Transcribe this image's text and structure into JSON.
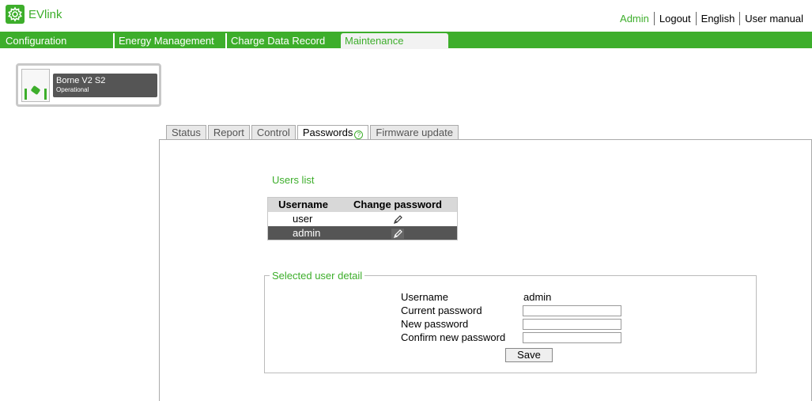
{
  "app": {
    "title": "EVlink"
  },
  "top_links": {
    "user": "Admin",
    "logout": "Logout",
    "language": "English",
    "manual": "User manual"
  },
  "nav": {
    "configuration": "Configuration",
    "energy": "Energy Management",
    "cdr": "Charge Data Record",
    "maintenance": "Maintenance"
  },
  "station": {
    "name": "Borne V2 S2",
    "status": "Operational"
  },
  "tabs": {
    "status": "Status",
    "report": "Report",
    "control": "Control",
    "passwords": "Passwords",
    "firmware": "Firmware update",
    "help_glyph": "?"
  },
  "users": {
    "title": "Users list",
    "col_username": "Username",
    "col_change": "Change password",
    "rows": [
      {
        "username": "user"
      },
      {
        "username": "admin"
      }
    ],
    "selected_index": 1
  },
  "detail": {
    "legend": "Selected user detail",
    "username_label": "Username",
    "username_value": "admin",
    "current_label": "Current password",
    "new_label": "New password",
    "confirm_label": "Confirm new password",
    "current_value": "",
    "new_value": "",
    "confirm_value": "",
    "save": "Save"
  },
  "colors": {
    "accent": "#3dae2b",
    "selected_row": "#555555"
  }
}
